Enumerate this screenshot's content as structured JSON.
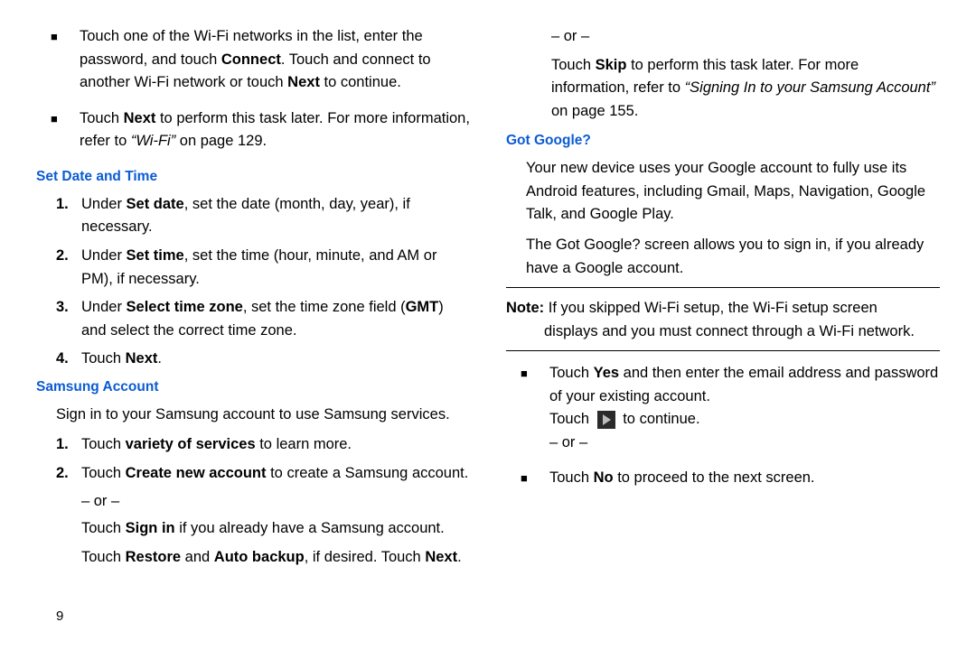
{
  "pageNumber": "9",
  "left": {
    "bullets": [
      {
        "parts": [
          {
            "t": "Touch one of the Wi-Fi networks in the list, enter the password, and touch "
          },
          {
            "t": "Connect",
            "b": true
          },
          {
            "t": ". Touch and connect to another Wi-Fi network or touch "
          },
          {
            "t": "Next",
            "b": true
          },
          {
            "t": " to continue."
          }
        ]
      },
      {
        "parts": [
          {
            "t": "Touch "
          },
          {
            "t": "Next",
            "b": true
          },
          {
            "t": "  to perform this task later. For more information, refer to "
          },
          {
            "t": "“Wi-Fi”",
            "i": true
          },
          {
            "t": " on page 129."
          }
        ]
      }
    ],
    "heading1": "Set Date and Time",
    "steps1": [
      {
        "n": "1.",
        "parts": [
          {
            "t": "Under "
          },
          {
            "t": "Set date",
            "b": true
          },
          {
            "t": ", set the date (month, day, year), if necessary."
          }
        ]
      },
      {
        "n": "2.",
        "parts": [
          {
            "t": "Under "
          },
          {
            "t": "Set time",
            "b": true
          },
          {
            "t": ", set the time (hour, minute, and AM or PM), if necessary."
          }
        ]
      },
      {
        "n": "3.",
        "parts": [
          {
            "t": "Under "
          },
          {
            "t": "Select time zone",
            "b": true
          },
          {
            "t": ", set the time zone field ("
          },
          {
            "t": "GMT",
            "b": true
          },
          {
            "t": ") and select the correct time zone."
          }
        ]
      },
      {
        "n": "4.",
        "parts": [
          {
            "t": "Touch "
          },
          {
            "t": "Next",
            "b": true
          },
          {
            "t": "."
          }
        ]
      }
    ],
    "heading2": "Samsung Account",
    "intro2": "Sign in to your Samsung account to use Samsung services.",
    "steps2": [
      {
        "n": "1.",
        "parts": [
          {
            "t": "Touch "
          },
          {
            "t": "variety of services",
            "b": true
          },
          {
            "t": " to learn more."
          }
        ]
      },
      {
        "n": "2.",
        "parts": [
          {
            "t": "Touch "
          },
          {
            "t": "Create new account",
            "b": true
          },
          {
            "t": " to create a Samsung account."
          }
        ]
      }
    ],
    "or": "– or –",
    "after2": [
      {
        "t": "Touch "
      },
      {
        "t": "Sign in",
        "b": true
      },
      {
        "t": " if you already have a Samsung account."
      }
    ],
    "after2b": [
      {
        "t": "Touch "
      },
      {
        "t": "Restore",
        "b": true
      },
      {
        "t": " and "
      },
      {
        "t": "Auto backup",
        "b": true
      },
      {
        "t": ", if desired. Touch "
      },
      {
        "t": "Next",
        "b": true
      },
      {
        "t": "."
      }
    ]
  },
  "right": {
    "orTop": "– or –",
    "blockTop": [
      {
        "t": "Touch "
      },
      {
        "t": "Skip",
        "b": true
      },
      {
        "t": " to perform this task later. For more information, refer to "
      },
      {
        "t": "“Signing In to your Samsung Account”",
        "i": true
      },
      {
        "t": " on page 155."
      }
    ],
    "heading": "Got Google?",
    "para1": "Your new device uses your Google account to fully use its Android features, including Gmail, Maps, Navigation, Google Talk, and Google Play.",
    "para2": "The Got Google? screen allows you to sign in, if you already have a Google account.",
    "noteLabel": "Note:",
    "noteText": "If you skipped Wi-Fi setup, the Wi-Fi setup screen displays and you must connect through a Wi-Fi network.",
    "bullets": [
      {
        "parts": [
          {
            "t": "Touch "
          },
          {
            "t": "Yes",
            "b": true
          },
          {
            "t": " and then enter the email address and password of your existing account."
          }
        ],
        "tailTouch": "Touch ",
        "tailCont": " to continue.",
        "or": "– or –"
      },
      {
        "parts": [
          {
            "t": "Touch "
          },
          {
            "t": "No",
            "b": true
          },
          {
            "t": " to proceed to the next screen."
          }
        ]
      }
    ]
  }
}
